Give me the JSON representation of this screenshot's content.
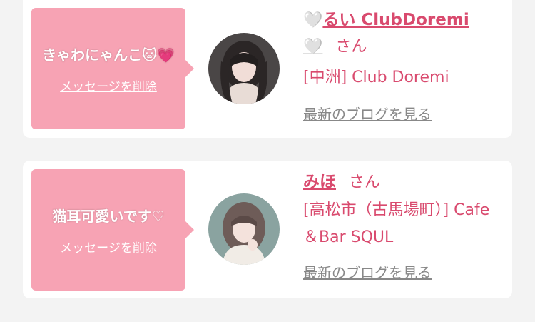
{
  "messages": [
    {
      "bubble_text": "きゃわにゃんこ🐱💗",
      "delete_label": "メッセージを削除",
      "heart_1": "🤍",
      "name": "るい ClubDoremi",
      "heart_2": "🤍",
      "honorific": "さん",
      "shop": "[中洲] Club Doremi",
      "blog_link": "最新のブログを見る"
    },
    {
      "bubble_text": "猫耳可愛いです♡",
      "delete_label": "メッセージを削除",
      "name": "みほ",
      "honorific": "さん",
      "shop": "[高松市（古馬場町）] Cafe＆Bar SQUL",
      "blog_link": "最新のブログを見る"
    }
  ],
  "colors": {
    "bubble": "#f7a3b4",
    "accent": "#d94a6e",
    "link_gray": "#888888"
  }
}
